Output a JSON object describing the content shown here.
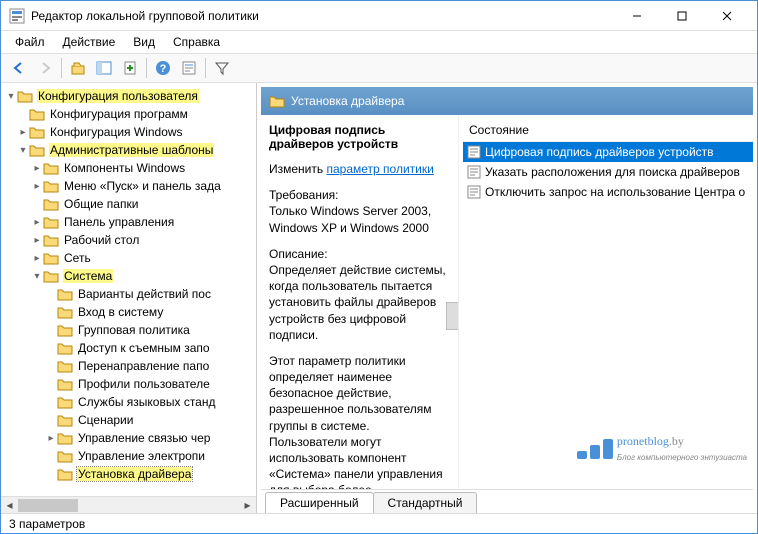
{
  "titlebar": {
    "title": "Редактор локальной групповой политики"
  },
  "menu": {
    "file": "Файл",
    "action": "Действие",
    "view": "Вид",
    "help": "Справка"
  },
  "tree": {
    "n0": "Конфигурация пользователя",
    "n1": "Конфигурация программ",
    "n2": "Конфигурация Windows",
    "n3": "Административные шаблоны",
    "n4": "Компоненты Windows",
    "n5": "Меню «Пуск» и панель зада",
    "n6": "Общие папки",
    "n7": "Панель управления",
    "n8": "Рабочий стол",
    "n9": "Сеть",
    "n10": "Система",
    "n11": "Варианты действий пос",
    "n12": "Вход в систему",
    "n13": "Групповая политика",
    "n14": "Доступ к съемным запо",
    "n15": "Перенаправление папо",
    "n16": "Профили пользователе",
    "n17": "Службы языковых станд",
    "n18": "Сценарии",
    "n19": "Управление связью чер",
    "n20": "Управление электропи",
    "n21": "Установка драйвера"
  },
  "rhead": {
    "title": "Установка драйвера"
  },
  "detail": {
    "title": "Цифровая подпись драйверов устройств",
    "edit_label": "Изменить",
    "edit_link": "параметр политики",
    "req_h": "Требования:",
    "req_t": "Только Windows Server 2003, Windows XP и Windows 2000",
    "desc_h": "Описание:",
    "desc_t": "Определяет действие системы, когда пользователь пытается установить файлы драйверов устройств без цифровой подписи.",
    "desc_t2": "Этот параметр политики определяет наименее безопасное действие, разрешенное пользователям группы в системе. Пользователи могут использовать компонент «Система» панели управления для выбора более"
  },
  "list": {
    "col": "Состояние",
    "r0": "Цифровая подпись драйверов устройств",
    "r1": "Указать расположения для поиска драйверов",
    "r2": "Отключить запрос на использование Центра о"
  },
  "tabs": {
    "ext": "Расширенный",
    "std": "Стандартный"
  },
  "status": {
    "text": "3 параметров"
  },
  "watermark": {
    "name": "pronetblog",
    "tld": ".by",
    "sub": "Блог компьютерного энтузиаста"
  }
}
